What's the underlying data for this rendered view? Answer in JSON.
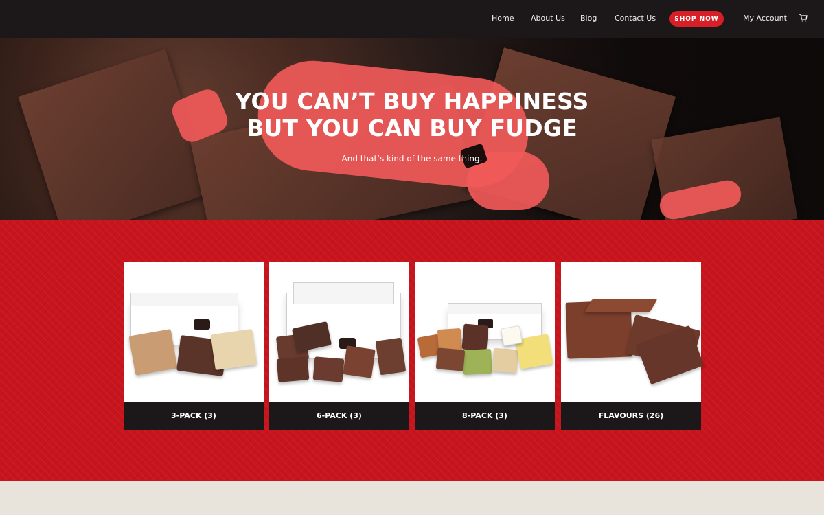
{
  "nav": {
    "items": [
      "Home",
      "About Us",
      "Blog",
      "Contact Us"
    ],
    "shop_now": "SHOP NOW",
    "my_account": "My Account"
  },
  "hero": {
    "title_line1": "YOU CAN’T BUY HAPPINESS",
    "title_line2": "BUT YOU CAN BUY FUDGE",
    "subtitle": "And that’s kind of the same thing."
  },
  "products": [
    {
      "label": "3-PACK (3)"
    },
    {
      "label": "6-PACK (3)"
    },
    {
      "label": "8-PACK (3)"
    },
    {
      "label": "FLAVOURS (26)"
    }
  ],
  "colors": {
    "brand_red": "#d61f26",
    "nav_background": "#1c1718",
    "hero_glaze": "#f05a59"
  },
  "icons": {
    "cart": "cart-icon"
  }
}
